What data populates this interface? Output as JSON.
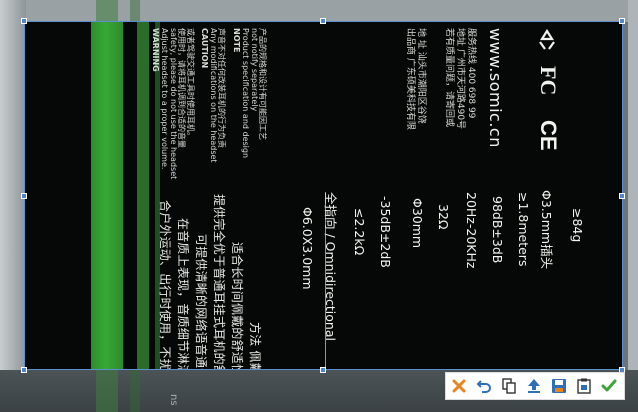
{
  "photo": {
    "background_text": "ns",
    "crop_content": {
      "cn_lines": [
        "合户外运动、出行时使用，不扰乱发型",
        "在音质上表现，音质细节淋漓尽显",
        "可提供清晰的网络语音通信",
        "提供完全优于普通耳挂式耳机的舒适性",
        "适合长时间佩戴的舒适性",
        "方法  佩戴"
      ],
      "warning": {
        "title": "WARNING",
        "lines": [
          "Adjust headset to a proper volume.",
          "safety, please do not use the headset",
          "使用时，请将耳机调到合适的音量",
          "或者驾驶交通工具时使用耳机。"
        ]
      },
      "caution": {
        "title": "CAUTION",
        "lines": [
          "Any modifications on the headset",
          "声音不对任何改装耳机的行为负责"
        ]
      },
      "note": {
        "title": "NOTE",
        "lines": [
          "Product specification and design",
          "not notify separately",
          "产品的规格和设计有可能因工艺"
        ]
      },
      "specs": [
        "Φ6.0X3.0mm",
        "全指向 / Omnidirectional",
        "≤2.2kΩ",
        "-35dB±2dB",
        "Φ30mm",
        "32Ω",
        "20Hz-20KHz",
        "98dB±3dB",
        "≥1.8meters",
        "Φ3.5mm插头",
        "≥84g"
      ],
      "company_lines": [
        "出品商  广东硕美科技有限",
        "地  址  汕头市潮阳区谷饶"
      ],
      "maker_lines": [
        "若有质量问题，请寄回或",
        "地址  广州市天河路490号",
        "服务热线  400 698 99"
      ],
      "website": "www.somic.cn",
      "marks": {
        "ce": "CE",
        "fc": "FC"
      }
    }
  },
  "toolbar": {
    "buttons": [
      {
        "name": "cancel-button",
        "icon": "close-icon",
        "color": "#e8831e"
      },
      {
        "name": "undo-button",
        "icon": "undo-icon",
        "color": "#2f6fb7"
      },
      {
        "name": "copy-button",
        "icon": "copy-icon",
        "color": "#333333"
      },
      {
        "name": "upload-button",
        "icon": "upload-icon",
        "color": "#2f6fb7"
      },
      {
        "name": "save-button",
        "icon": "save-icon",
        "color": "#2f6fb7"
      },
      {
        "name": "clipboard-button",
        "icon": "clipboard-icon",
        "color": "#333333"
      },
      {
        "name": "confirm-button",
        "icon": "checkmark-icon",
        "color": "#3aa53a"
      }
    ]
  },
  "colors": {
    "selection_border": "#5b8fd0",
    "packaging_green": "#37a935"
  }
}
